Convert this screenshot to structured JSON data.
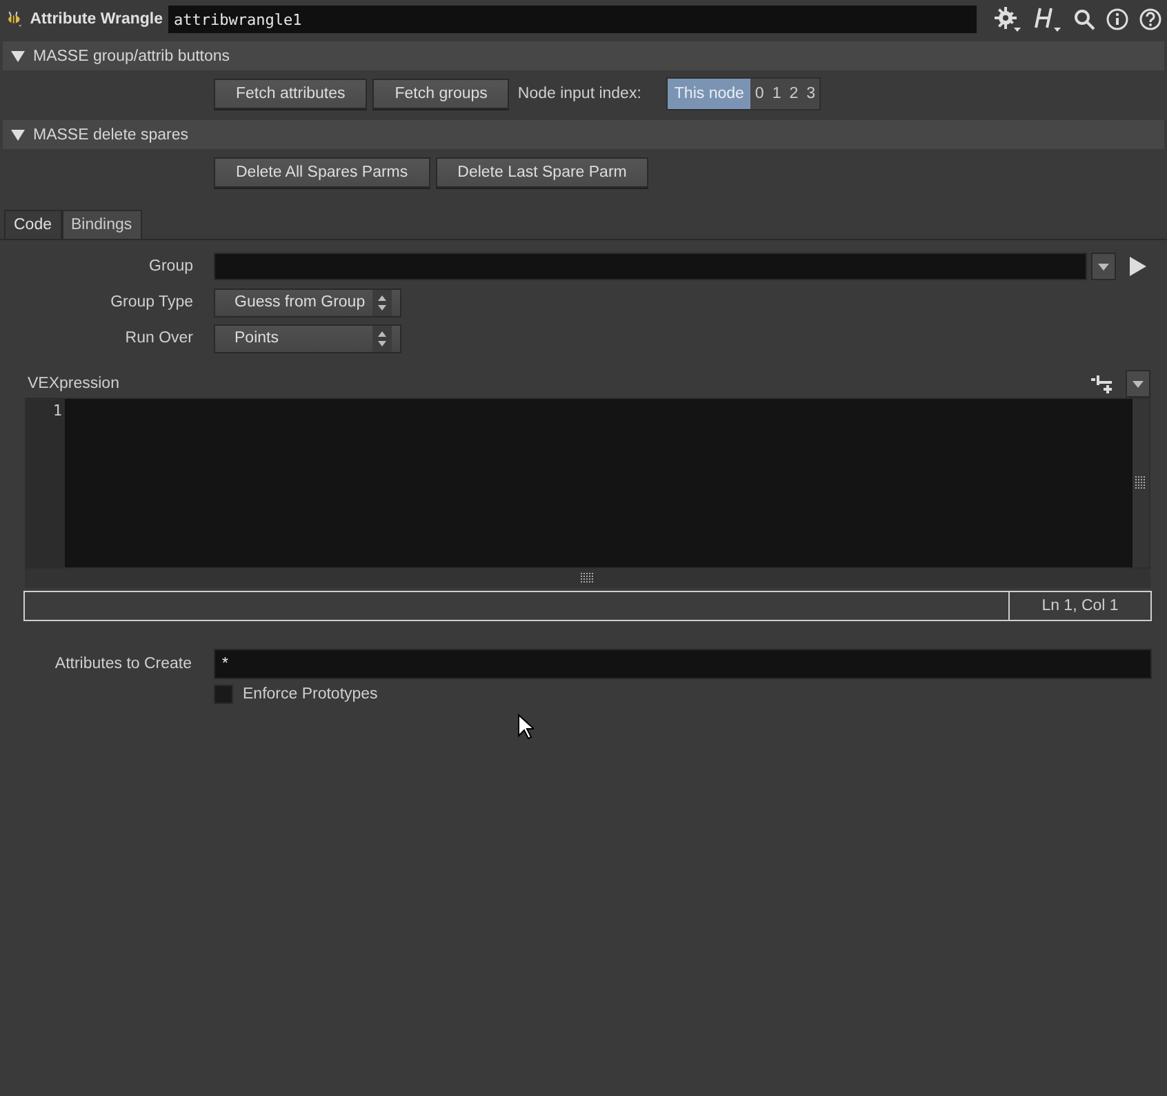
{
  "header": {
    "node_type": "Attribute Wrangle",
    "node_name": "attribwrangle1"
  },
  "folders": [
    {
      "label": "MASSE group/attrib buttons",
      "expanded": true,
      "buttons": [
        "Fetch attributes",
        "Fetch groups"
      ],
      "input_index": {
        "label": "Node input index:",
        "options": [
          {
            "label": "This node",
            "selected": true
          },
          {
            "label": "0",
            "selected": false
          },
          {
            "label": "1",
            "selected": false
          },
          {
            "label": "2",
            "selected": false
          },
          {
            "label": "3",
            "selected": false
          }
        ]
      }
    },
    {
      "label": "MASSE delete spares",
      "expanded": true,
      "buttons": [
        "Delete All Spares Parms",
        "Delete Last Spare Parm"
      ]
    }
  ],
  "tabs": [
    {
      "label": "Code",
      "selected": true
    },
    {
      "label": "Bindings",
      "selected": false
    }
  ],
  "parameters": [
    {
      "kind": "field",
      "label": "Group"
    },
    {
      "kind": "menu",
      "label": "Group Type",
      "value": "Guess from Group"
    },
    {
      "kind": "menu",
      "label": "Run Over",
      "value": "Points"
    }
  ],
  "vexpression": {
    "label": "VEXpression",
    "line_numbers": [
      "1"
    ],
    "status": "Ln 1, Col 1"
  },
  "attributes_to_create": {
    "label": "Attributes to Create",
    "value": "*"
  },
  "enforce_prototypes": {
    "label": "Enforce Prototypes",
    "checked": false
  }
}
